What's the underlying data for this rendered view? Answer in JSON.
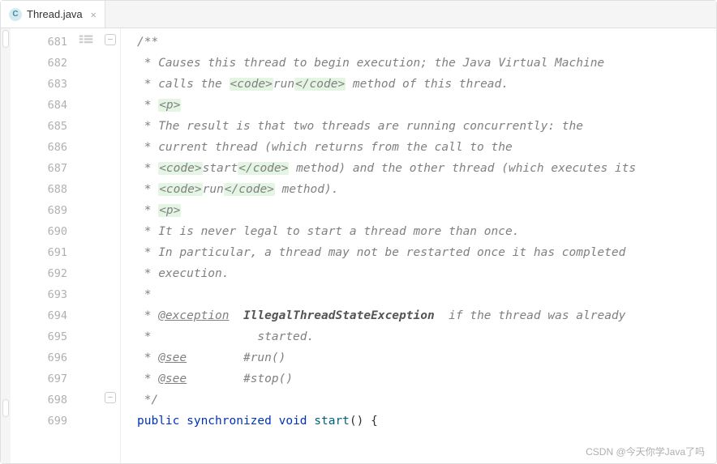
{
  "tab": {
    "icon_letter": "C",
    "filename": "Thread.java"
  },
  "gutter": {
    "start": 681,
    "end": 699
  },
  "code": {
    "lines": [
      {
        "type": "doc",
        "segments": [
          {
            "t": "/**"
          }
        ]
      },
      {
        "type": "doc",
        "segments": [
          {
            "t": " * Causes this thread to begin execution; the Java Virtual Machine"
          }
        ]
      },
      {
        "type": "doc",
        "segments": [
          {
            "t": " * calls the "
          },
          {
            "t": "<code>",
            "cls": "html-tag"
          },
          {
            "t": "run"
          },
          {
            "t": "</code>",
            "cls": "html-tag"
          },
          {
            "t": " method of this thread."
          }
        ]
      },
      {
        "type": "doc",
        "segments": [
          {
            "t": " * "
          },
          {
            "t": "<p>",
            "cls": "html-tag"
          }
        ]
      },
      {
        "type": "doc",
        "segments": [
          {
            "t": " * The result is that two threads are running concurrently: the"
          }
        ]
      },
      {
        "type": "doc",
        "segments": [
          {
            "t": " * current thread (which returns from the call to the"
          }
        ]
      },
      {
        "type": "doc",
        "segments": [
          {
            "t": " * "
          },
          {
            "t": "<code>",
            "cls": "html-tag"
          },
          {
            "t": "start"
          },
          {
            "t": "</code>",
            "cls": "html-tag"
          },
          {
            "t": " method) and the other thread (which executes its"
          }
        ]
      },
      {
        "type": "doc",
        "segments": [
          {
            "t": " * "
          },
          {
            "t": "<code>",
            "cls": "html-tag"
          },
          {
            "t": "run"
          },
          {
            "t": "</code>",
            "cls": "html-tag"
          },
          {
            "t": " method)."
          }
        ]
      },
      {
        "type": "doc",
        "segments": [
          {
            "t": " * "
          },
          {
            "t": "<p>",
            "cls": "html-tag"
          }
        ]
      },
      {
        "type": "doc",
        "segments": [
          {
            "t": " * It is never legal to start a thread more than once."
          }
        ]
      },
      {
        "type": "doc",
        "segments": [
          {
            "t": " * In particular, a thread may not be restarted once it has completed"
          }
        ]
      },
      {
        "type": "doc",
        "segments": [
          {
            "t": " * execution."
          }
        ]
      },
      {
        "type": "doc",
        "segments": [
          {
            "t": " *"
          }
        ]
      },
      {
        "type": "doc",
        "segments": [
          {
            "t": " * "
          },
          {
            "t": "@exception",
            "cls": "doc-tag"
          },
          {
            "t": "  "
          },
          {
            "t": "IllegalThreadStateException",
            "cls": "doc-bold"
          },
          {
            "t": "  if the thread was already"
          }
        ]
      },
      {
        "type": "doc",
        "segments": [
          {
            "t": " *               started."
          }
        ]
      },
      {
        "type": "doc",
        "segments": [
          {
            "t": " * "
          },
          {
            "t": "@see",
            "cls": "doc-tag"
          },
          {
            "t": "        #run()"
          }
        ]
      },
      {
        "type": "doc",
        "segments": [
          {
            "t": " * "
          },
          {
            "t": "@see",
            "cls": "doc-tag"
          },
          {
            "t": "        #stop()"
          }
        ]
      },
      {
        "type": "doc",
        "segments": [
          {
            "t": " */"
          }
        ]
      },
      {
        "type": "code",
        "segments": [
          {
            "t": "public ",
            "cls": "kw"
          },
          {
            "t": "synchronized ",
            "cls": "kw"
          },
          {
            "t": "void ",
            "cls": "kw"
          },
          {
            "t": "start",
            "cls": "method-decl"
          },
          {
            "t": "() {",
            "cls": "plain"
          }
        ]
      }
    ]
  },
  "watermark": "CSDN @今天你学Java了吗"
}
